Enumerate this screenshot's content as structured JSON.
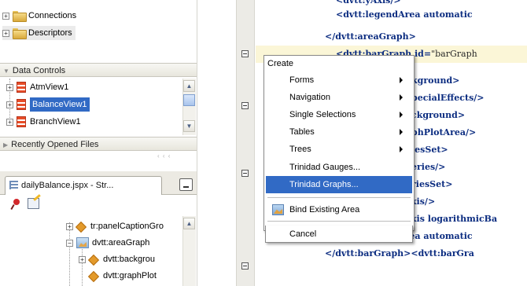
{
  "navigator": {
    "tree_top": [
      {
        "label": "Connections",
        "icon": "folder-icon"
      },
      {
        "label": "Descriptors",
        "icon": "folder-icon"
      }
    ],
    "data_controls": {
      "header": "Data Controls",
      "items": [
        {
          "label": "AtmView1",
          "icon": "data-control-icon"
        },
        {
          "label": "BalanceView1",
          "icon": "data-control-icon",
          "selected": true
        },
        {
          "label": "BranchView1",
          "icon": "data-control-icon"
        }
      ]
    },
    "recently_opened": {
      "header": "Recently Opened Files"
    },
    "structure_tab": {
      "label": "dailyBalance.jspx - Str..."
    },
    "structure_items": [
      {
        "label": "tr:panelCaptionGro",
        "icon": "xml-element-icon"
      },
      {
        "label": "dvtt:areaGraph",
        "icon": "graph-icon"
      },
      {
        "label": "dvtt:backgrou",
        "icon": "xml-element-icon"
      },
      {
        "label": "dvtt:graphPlot",
        "icon": "xml-element-icon"
      }
    ]
  },
  "editor": {
    "lines": [
      {
        "text": "<dvtt:yAxis/>",
        "attr": ""
      },
      {
        "text": "<dvtt:legendArea automatic",
        "attr": ""
      },
      {
        "text": "</dvtt:areaGraph>",
        "attr": ""
      },
      {
        "text": "<dvtt:barGraph id=",
        "attr": "\"barGraph"
      },
      {
        "text": "kground>",
        "attr": ""
      },
      {
        "text": "pecialEffects/>",
        "attr": ""
      },
      {
        "text": "ckground>",
        "attr": ""
      },
      {
        "text": "phPlotArea/>",
        "attr": ""
      },
      {
        "text": "iesSet>",
        "attr": ""
      },
      {
        "text": "eries/>",
        "attr": ""
      },
      {
        "text": "riesSet>",
        "attr": ""
      },
      {
        "text": "xis/>",
        "attr": ""
      },
      {
        "text": "xis logarithmicBa",
        "attr": ""
      },
      {
        "text": "<dvtt:legendArea automatic",
        "attr": ""
      },
      {
        "text": "</dvtt:barGraph><dvtt:barGra",
        "attr": ""
      }
    ]
  },
  "context_menu": {
    "header": "Create",
    "items": [
      {
        "label": "Forms",
        "submenu": true
      },
      {
        "label": "Navigation",
        "submenu": true
      },
      {
        "label": "Single Selections",
        "submenu": true
      },
      {
        "label": "Tables",
        "submenu": true
      },
      {
        "label": "Trees",
        "submenu": true
      },
      {
        "label": "Trinidad Gauges...",
        "submenu": false
      },
      {
        "label": "Trinidad Graphs...",
        "submenu": false,
        "active": true
      },
      {
        "label": "Bind Existing Area",
        "submenu": false,
        "icon": "graph-icon"
      },
      {
        "label": "Cancel",
        "submenu": false
      }
    ]
  },
  "colors": {
    "selection": "#316ac5",
    "code_tag": "#0b2c80",
    "current_line": "#fbf6d7"
  }
}
